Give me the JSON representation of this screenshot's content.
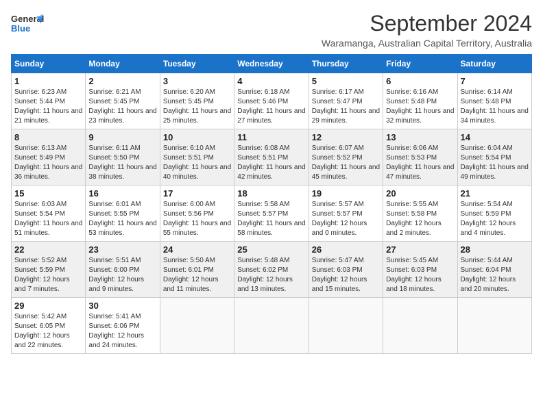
{
  "header": {
    "logo_general": "General",
    "logo_blue": "Blue",
    "month_title": "September 2024",
    "location": "Waramanga, Australian Capital Territory, Australia"
  },
  "calendar": {
    "headers": [
      "Sunday",
      "Monday",
      "Tuesday",
      "Wednesday",
      "Thursday",
      "Friday",
      "Saturday"
    ],
    "weeks": [
      [
        {
          "day": "1",
          "sunrise": "6:23 AM",
          "sunset": "5:44 PM",
          "daylight": "11 hours and 21 minutes."
        },
        {
          "day": "2",
          "sunrise": "6:21 AM",
          "sunset": "5:45 PM",
          "daylight": "11 hours and 23 minutes."
        },
        {
          "day": "3",
          "sunrise": "6:20 AM",
          "sunset": "5:45 PM",
          "daylight": "11 hours and 25 minutes."
        },
        {
          "day": "4",
          "sunrise": "6:18 AM",
          "sunset": "5:46 PM",
          "daylight": "11 hours and 27 minutes."
        },
        {
          "day": "5",
          "sunrise": "6:17 AM",
          "sunset": "5:47 PM",
          "daylight": "11 hours and 29 minutes."
        },
        {
          "day": "6",
          "sunrise": "6:16 AM",
          "sunset": "5:48 PM",
          "daylight": "11 hours and 32 minutes."
        },
        {
          "day": "7",
          "sunrise": "6:14 AM",
          "sunset": "5:48 PM",
          "daylight": "11 hours and 34 minutes."
        }
      ],
      [
        {
          "day": "8",
          "sunrise": "6:13 AM",
          "sunset": "5:49 PM",
          "daylight": "11 hours and 36 minutes."
        },
        {
          "day": "9",
          "sunrise": "6:11 AM",
          "sunset": "5:50 PM",
          "daylight": "11 hours and 38 minutes."
        },
        {
          "day": "10",
          "sunrise": "6:10 AM",
          "sunset": "5:51 PM",
          "daylight": "11 hours and 40 minutes."
        },
        {
          "day": "11",
          "sunrise": "6:08 AM",
          "sunset": "5:51 PM",
          "daylight": "11 hours and 42 minutes."
        },
        {
          "day": "12",
          "sunrise": "6:07 AM",
          "sunset": "5:52 PM",
          "daylight": "11 hours and 45 minutes."
        },
        {
          "day": "13",
          "sunrise": "6:06 AM",
          "sunset": "5:53 PM",
          "daylight": "11 hours and 47 minutes."
        },
        {
          "day": "14",
          "sunrise": "6:04 AM",
          "sunset": "5:54 PM",
          "daylight": "11 hours and 49 minutes."
        }
      ],
      [
        {
          "day": "15",
          "sunrise": "6:03 AM",
          "sunset": "5:54 PM",
          "daylight": "11 hours and 51 minutes."
        },
        {
          "day": "16",
          "sunrise": "6:01 AM",
          "sunset": "5:55 PM",
          "daylight": "11 hours and 53 minutes."
        },
        {
          "day": "17",
          "sunrise": "6:00 AM",
          "sunset": "5:56 PM",
          "daylight": "11 hours and 55 minutes."
        },
        {
          "day": "18",
          "sunrise": "5:58 AM",
          "sunset": "5:57 PM",
          "daylight": "11 hours and 58 minutes."
        },
        {
          "day": "19",
          "sunrise": "5:57 AM",
          "sunset": "5:57 PM",
          "daylight": "12 hours and 0 minutes."
        },
        {
          "day": "20",
          "sunrise": "5:55 AM",
          "sunset": "5:58 PM",
          "daylight": "12 hours and 2 minutes."
        },
        {
          "day": "21",
          "sunrise": "5:54 AM",
          "sunset": "5:59 PM",
          "daylight": "12 hours and 4 minutes."
        }
      ],
      [
        {
          "day": "22",
          "sunrise": "5:52 AM",
          "sunset": "5:59 PM",
          "daylight": "12 hours and 7 minutes."
        },
        {
          "day": "23",
          "sunrise": "5:51 AM",
          "sunset": "6:00 PM",
          "daylight": "12 hours and 9 minutes."
        },
        {
          "day": "24",
          "sunrise": "5:50 AM",
          "sunset": "6:01 PM",
          "daylight": "12 hours and 11 minutes."
        },
        {
          "day": "25",
          "sunrise": "5:48 AM",
          "sunset": "6:02 PM",
          "daylight": "12 hours and 13 minutes."
        },
        {
          "day": "26",
          "sunrise": "5:47 AM",
          "sunset": "6:03 PM",
          "daylight": "12 hours and 15 minutes."
        },
        {
          "day": "27",
          "sunrise": "5:45 AM",
          "sunset": "6:03 PM",
          "daylight": "12 hours and 18 minutes."
        },
        {
          "day": "28",
          "sunrise": "5:44 AM",
          "sunset": "6:04 PM",
          "daylight": "12 hours and 20 minutes."
        }
      ],
      [
        {
          "day": "29",
          "sunrise": "5:42 AM",
          "sunset": "6:05 PM",
          "daylight": "12 hours and 22 minutes."
        },
        {
          "day": "30",
          "sunrise": "5:41 AM",
          "sunset": "6:06 PM",
          "daylight": "12 hours and 24 minutes."
        },
        null,
        null,
        null,
        null,
        null
      ]
    ]
  }
}
